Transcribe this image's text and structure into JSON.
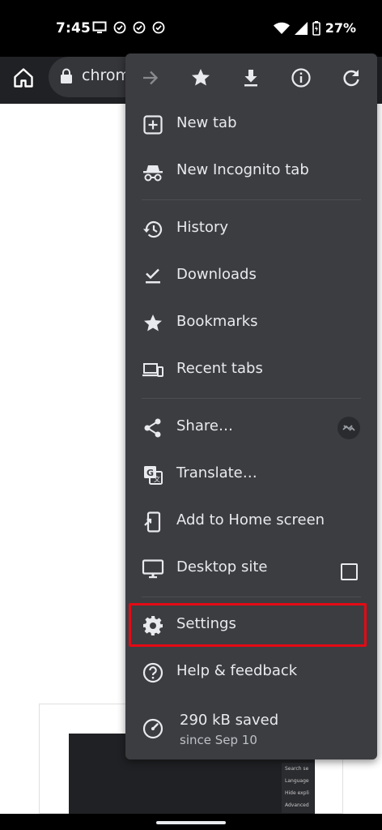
{
  "status_bar": {
    "time": "7:45",
    "battery_percent": "27%",
    "left_icons": [
      "screen-cast-icon",
      "check-circle-icon",
      "check-circle-icon",
      "check-circle-icon"
    ],
    "right_icons": [
      "wifi-icon",
      "signal-icon",
      "battery-charging-icon"
    ]
  },
  "toolbar": {
    "url_text": "chrom",
    "background_color": "#202124"
  },
  "menu": {
    "background_color": "#3c3d41",
    "top_actions": [
      "forward-icon",
      "bookmark-star-icon",
      "download-icon",
      "info-icon",
      "reload-icon"
    ],
    "items": [
      {
        "label": "New tab",
        "icon": "new-tab-icon"
      },
      {
        "label": "New Incognito tab",
        "icon": "incognito-icon"
      },
      {
        "label": "History",
        "icon": "history-icon"
      },
      {
        "label": "Downloads",
        "icon": "downloads-icon"
      },
      {
        "label": "Bookmarks",
        "icon": "bookmarks-star-icon"
      },
      {
        "label": "Recent tabs",
        "icon": "recent-tabs-icon"
      },
      {
        "label": "Share…",
        "icon": "share-icon"
      },
      {
        "label": "Translate…",
        "icon": "translate-icon"
      },
      {
        "label": "Add to Home screen",
        "icon": "add-to-home-icon"
      },
      {
        "label": "Desktop site",
        "icon": "desktop-icon",
        "checked": false
      },
      {
        "label": "Settings",
        "icon": "settings-gear-icon",
        "highlighted": true
      },
      {
        "label": "Help & feedback",
        "icon": "help-icon"
      }
    ],
    "data_saver": {
      "title": "290 kB saved",
      "subtitle": "since Sep 10",
      "icon": "speedometer-icon"
    }
  },
  "highlight_color": "#e40a14",
  "background_thumbnail": {
    "menu_lines": [
      "Search se",
      "Language",
      "Hide expli",
      "Advanced"
    ]
  }
}
